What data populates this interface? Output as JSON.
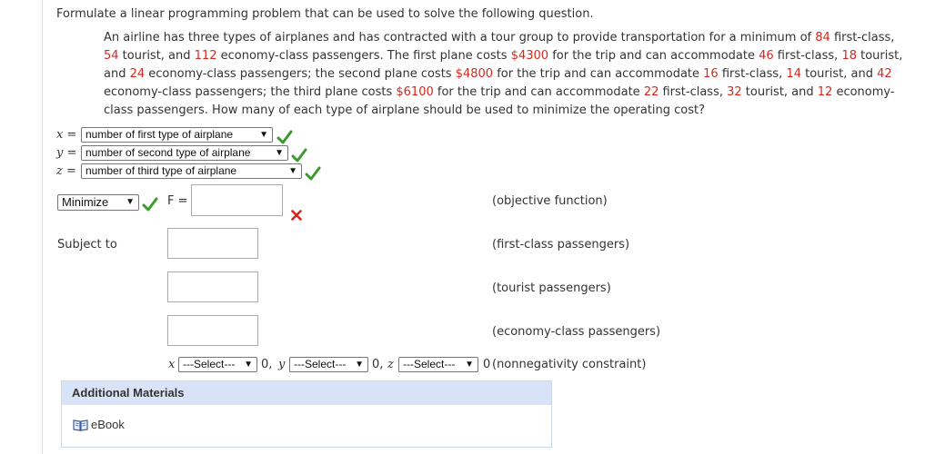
{
  "question": "Formulate a linear programming problem that can be used to solve the following question.",
  "problem": {
    "p1": "An airline has three types of airplanes and has contracted with a tour group to provide transportation for a minimum of ",
    "n1": "84",
    "p2": " first-class, ",
    "n2": "54",
    "p3": " tourist, and ",
    "n3": "112",
    "p4": " economy-class passengers. The first plane costs ",
    "n4": "$4300",
    "p5": " for the trip and can accommodate ",
    "n5": "46",
    "p6": " first-class, ",
    "n6": "18",
    "p7": " tourist, and ",
    "n7": "24",
    "p8": " economy-class passengers; the second plane costs ",
    "n8": "$4800",
    "p9": " for the trip and can accommodate ",
    "n9": "16",
    "p10": " first-class, ",
    "n10": "14",
    "p11": " tourist, and ",
    "n11": "42",
    "p12": " economy-class passengers; the third plane costs ",
    "n12": "$6100",
    "p13": " for the trip and can accommodate ",
    "n13": "22",
    "p14": " first-class, ",
    "n14": "32",
    "p15": " tourist, and ",
    "n15": "12",
    "p16": " economy-class passengers. How many of each type of airplane should be used to minimize the operating cost?"
  },
  "variables": [
    {
      "name": "x =",
      "value": "number of first type of airplane"
    },
    {
      "name": "y =",
      "value": "number of second type of airplane"
    },
    {
      "name": "z =",
      "value": "number of third type of airplane"
    }
  ],
  "objective": {
    "select": "Minimize",
    "f_label": "F =",
    "f_value": "",
    "note": "(objective function)"
  },
  "constraints": {
    "subject_to": "Subject to",
    "items": [
      {
        "value": "",
        "note": "(first-class passengers)"
      },
      {
        "value": "",
        "note": "(tourist passengers)"
      },
      {
        "value": "",
        "note": "(economy-class passengers)"
      }
    ]
  },
  "nonneg": {
    "x": "x",
    "y": "y",
    "z": "z",
    "select_x": "---Select---",
    "select_y": "---Select---",
    "select_z": "---Select---",
    "zero_x": "0,",
    "zero_y": "0,",
    "zero_z": "0",
    "note": "(nonnegativity constraint)"
  },
  "additional": {
    "title": "Additional Materials",
    "ebook": "eBook"
  },
  "colors": {
    "number_red": "#d9261c",
    "check_green": "#3c9a2c",
    "cross_red": "#d9261c"
  }
}
